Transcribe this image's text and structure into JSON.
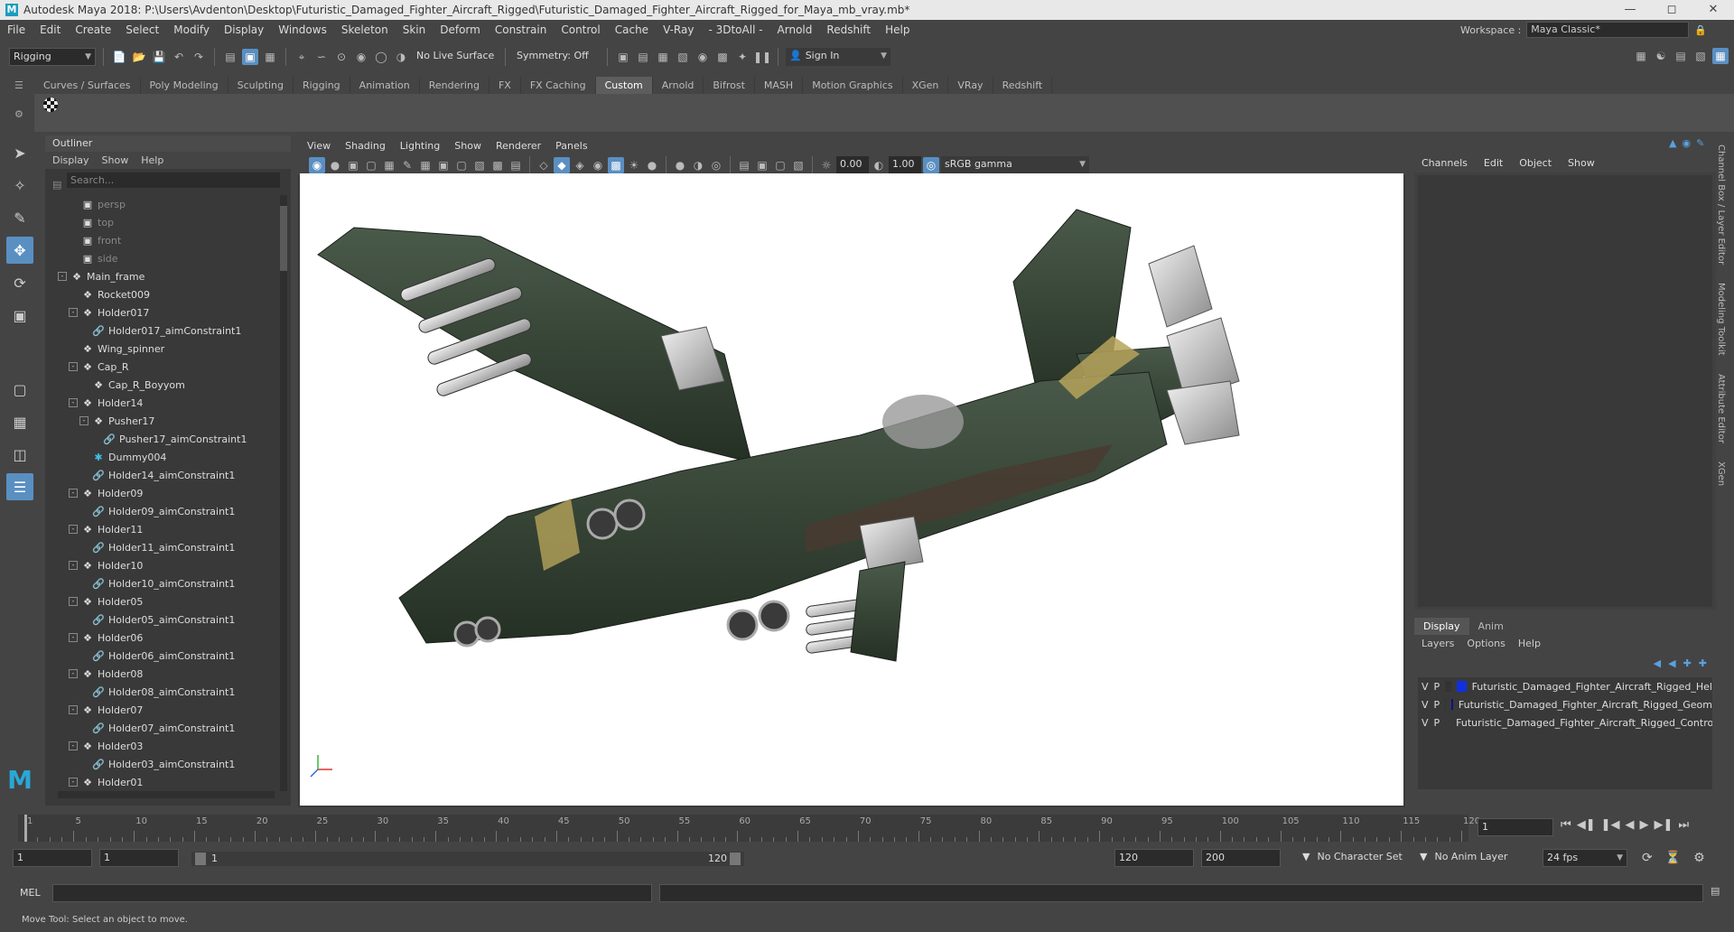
{
  "title": "Autodesk Maya 2018: P:\\Users\\Avdenton\\Desktop\\Futuristic_Damaged_Fighter_Aircraft_Rigged\\Futuristic_Damaged_Fighter_Aircraft_Rigged_for_Maya_mb_vray.mb*",
  "menus": [
    "File",
    "Edit",
    "Create",
    "Select",
    "Modify",
    "Display",
    "Windows",
    "Skeleton",
    "Skin",
    "Deform",
    "Constrain",
    "Control",
    "Cache",
    "V-Ray",
    "- 3DtoAll -",
    "Arnold",
    "Redshift",
    "Help"
  ],
  "workspace": {
    "label": "Workspace :",
    "value": "Maya Classic*"
  },
  "status": {
    "mode": "Rigging",
    "live_surface": "No Live Surface",
    "symmetry": "Symmetry: Off",
    "sign_in": "Sign In"
  },
  "shelf_tabs": [
    "Curves / Surfaces",
    "Poly Modeling",
    "Sculpting",
    "Rigging",
    "Animation",
    "Rendering",
    "FX",
    "FX Caching",
    "Custom",
    "Arnold",
    "Bifrost",
    "MASH",
    "Motion Graphics",
    "XGen",
    "VRay",
    "Redshift"
  ],
  "shelf_active": "Custom",
  "outliner": {
    "title": "Outliner",
    "menu": [
      "Display",
      "Show",
      "Help"
    ],
    "search_placeholder": "Search...",
    "rows": [
      {
        "label": "persp",
        "type": "cam",
        "depth": 1,
        "dim": true
      },
      {
        "label": "top",
        "type": "cam",
        "depth": 1,
        "dim": true
      },
      {
        "label": "front",
        "type": "cam",
        "depth": 1,
        "dim": true
      },
      {
        "label": "side",
        "type": "cam",
        "depth": 1,
        "dim": true
      },
      {
        "label": "Main_frame",
        "type": "mesh",
        "depth": 0,
        "exp": "-"
      },
      {
        "label": "Rocket009",
        "type": "mesh",
        "depth": 1
      },
      {
        "label": "Holder017",
        "type": "mesh",
        "depth": 1,
        "exp": "-"
      },
      {
        "label": "Holder017_aimConstraint1",
        "type": "con",
        "depth": 2
      },
      {
        "label": "Wing_spinner",
        "type": "mesh",
        "depth": 1
      },
      {
        "label": "Cap_R",
        "type": "mesh",
        "depth": 1,
        "exp": "-"
      },
      {
        "label": "Cap_R_Boyyom",
        "type": "mesh",
        "depth": 2
      },
      {
        "label": "Holder14",
        "type": "mesh",
        "depth": 1,
        "exp": "-"
      },
      {
        "label": "Pusher17",
        "type": "mesh",
        "depth": 2,
        "exp": "-"
      },
      {
        "label": "Pusher17_aimConstraint1",
        "type": "con",
        "depth": 3
      },
      {
        "label": "Dummy004",
        "type": "dum",
        "depth": 2
      },
      {
        "label": "Holder14_aimConstraint1",
        "type": "con",
        "depth": 2
      },
      {
        "label": "Holder09",
        "type": "mesh",
        "depth": 1,
        "exp": "-"
      },
      {
        "label": "Holder09_aimConstraint1",
        "type": "con",
        "depth": 2
      },
      {
        "label": "Holder11",
        "type": "mesh",
        "depth": 1,
        "exp": "-"
      },
      {
        "label": "Holder11_aimConstraint1",
        "type": "con",
        "depth": 2
      },
      {
        "label": "Holder10",
        "type": "mesh",
        "depth": 1,
        "exp": "-"
      },
      {
        "label": "Holder10_aimConstraint1",
        "type": "con",
        "depth": 2
      },
      {
        "label": "Holder05",
        "type": "mesh",
        "depth": 1,
        "exp": "-"
      },
      {
        "label": "Holder05_aimConstraint1",
        "type": "con",
        "depth": 2
      },
      {
        "label": "Holder06",
        "type": "mesh",
        "depth": 1,
        "exp": "-"
      },
      {
        "label": "Holder06_aimConstraint1",
        "type": "con",
        "depth": 2
      },
      {
        "label": "Holder08",
        "type": "mesh",
        "depth": 1,
        "exp": "-"
      },
      {
        "label": "Holder08_aimConstraint1",
        "type": "con",
        "depth": 2
      },
      {
        "label": "Holder07",
        "type": "mesh",
        "depth": 1,
        "exp": "-"
      },
      {
        "label": "Holder07_aimConstraint1",
        "type": "con",
        "depth": 2
      },
      {
        "label": "Holder03",
        "type": "mesh",
        "depth": 1,
        "exp": "-"
      },
      {
        "label": "Holder03_aimConstraint1",
        "type": "con",
        "depth": 2
      },
      {
        "label": "Holder01",
        "type": "mesh",
        "depth": 1,
        "exp": "-"
      }
    ]
  },
  "viewport": {
    "menu": [
      "View",
      "Shading",
      "Lighting",
      "Show",
      "Renderer",
      "Panels"
    ],
    "exposure": "0.00",
    "gamma": "1.00",
    "colorspace": "sRGB gamma"
  },
  "channel_box": {
    "menu": [
      "Channels",
      "Edit",
      "Object",
      "Show"
    ]
  },
  "side_tabs": [
    "Channel Box / Layer Editor",
    "Modeling Toolkit",
    "Attribute Editor",
    "XGen"
  ],
  "layers": {
    "tabs": [
      "Display",
      "Anim"
    ],
    "menu": [
      "Layers",
      "Options",
      "Help"
    ],
    "rows": [
      {
        "v": "V",
        "p": "P",
        "color": "#1030e0",
        "name": "Futuristic_Damaged_Fighter_Aircraft_Rigged_Hel"
      },
      {
        "v": "V",
        "p": "P",
        "color": "#101080",
        "name": "Futuristic_Damaged_Fighter_Aircraft_Rigged_Geom"
      },
      {
        "v": "V",
        "p": "P",
        "color": "#a01030",
        "name": "Futuristic_Damaged_Fighter_Aircraft_Rigged_Contro"
      }
    ]
  },
  "timeline": {
    "start": 1,
    "end": 120,
    "step": 5,
    "labels": [
      "1",
      "5",
      "10",
      "15",
      "20",
      "25",
      "30",
      "35",
      "40",
      "45",
      "50",
      "55",
      "60",
      "65",
      "70",
      "75",
      "80",
      "85",
      "90",
      "95",
      "100",
      "105",
      "110",
      "115",
      "120"
    ],
    "current": "1"
  },
  "range": {
    "start": "1",
    "anim_start": "1",
    "slider_start": "1",
    "slider_end": "120",
    "end": "120",
    "anim_end": "200",
    "character_set": "No Character Set",
    "anim_layer": "No Anim Layer",
    "fps": "24 fps"
  },
  "mel": {
    "label": "MEL"
  },
  "help_line": "Move Tool: Select an object to move."
}
